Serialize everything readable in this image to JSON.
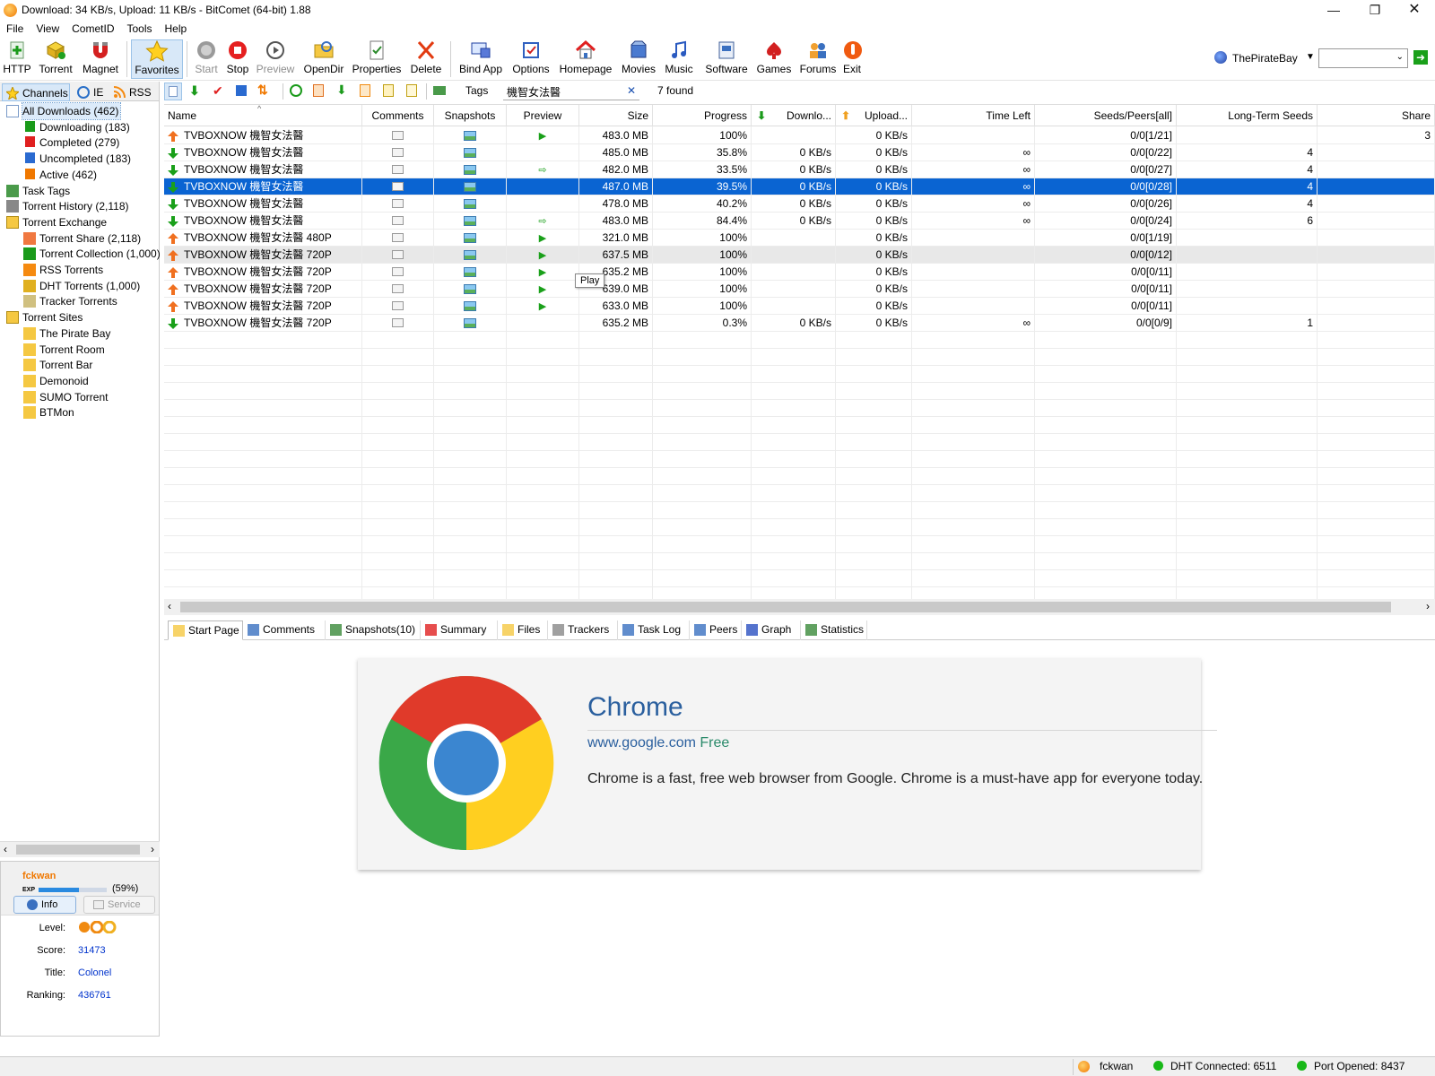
{
  "window": {
    "title": "Download: 34 KB/s, Upload: 11 KB/s - BitComet (64-bit) 1.88"
  },
  "menu": [
    "File",
    "View",
    "CometID",
    "Tools",
    "Help"
  ],
  "toolbar": {
    "buttons": [
      {
        "label": "HTTP",
        "icon": "http-add-icon"
      },
      {
        "label": "Torrent",
        "icon": "torrent-icon"
      },
      {
        "label": "Magnet",
        "icon": "magnet-icon"
      },
      {
        "label": "Favorites",
        "icon": "star-icon"
      },
      {
        "label": "Start",
        "icon": "start-icon"
      },
      {
        "label": "Stop",
        "icon": "stop-icon"
      },
      {
        "label": "Preview",
        "icon": "preview-icon"
      },
      {
        "label": "OpenDir",
        "icon": "folder-icon"
      },
      {
        "label": "Properties",
        "icon": "properties-icon"
      },
      {
        "label": "Delete",
        "icon": "delete-icon"
      },
      {
        "label": "Bind App",
        "icon": "bind-app-icon"
      },
      {
        "label": "Options",
        "icon": "options-icon"
      },
      {
        "label": "Homepage",
        "icon": "home-icon"
      },
      {
        "label": "Movies",
        "icon": "movies-icon"
      },
      {
        "label": "Music",
        "icon": "music-icon"
      },
      {
        "label": "Software",
        "icon": "software-icon"
      },
      {
        "label": "Games",
        "icon": "games-icon"
      },
      {
        "label": "Forums",
        "icon": "forums-icon"
      },
      {
        "label": "Exit",
        "icon": "exit-icon"
      }
    ],
    "site_name": "ThePirateBay",
    "search_value": ""
  },
  "left_tabs": [
    "Channels",
    "IE",
    "RSS"
  ],
  "tree": [
    {
      "label": "All Downloads (462)",
      "level": 0
    },
    {
      "label": "Downloading (183)",
      "level": 1
    },
    {
      "label": "Completed (279)",
      "level": 1
    },
    {
      "label": "Uncompleted (183)",
      "level": 1
    },
    {
      "label": "Active (462)",
      "level": 1
    },
    {
      "label": "Task Tags",
      "level": 0
    },
    {
      "label": "Torrent History (2,118)",
      "level": 0
    },
    {
      "label": "Torrent Exchange",
      "level": 0
    },
    {
      "label": "Torrent Share (2,118)",
      "level": 1
    },
    {
      "label": "Torrent Collection (1,000)",
      "level": 1
    },
    {
      "label": "RSS Torrents",
      "level": 1
    },
    {
      "label": "DHT Torrents (1,000)",
      "level": 1
    },
    {
      "label": "Tracker Torrents",
      "level": 1
    },
    {
      "label": "Torrent Sites",
      "level": 0
    },
    {
      "label": "The Pirate Bay",
      "level": 1
    },
    {
      "label": "Torrent Room",
      "level": 1
    },
    {
      "label": "Torrent Bar",
      "level": 1
    },
    {
      "label": "Demonoid",
      "level": 1
    },
    {
      "label": "SUMO Torrent",
      "level": 1
    },
    {
      "label": "BTMon",
      "level": 1
    }
  ],
  "user": {
    "name": "fckwan",
    "exp_label": "EXP",
    "exp_percent": "(59%)",
    "exp_fraction": 0.59,
    "tab_info": "Info",
    "tab_service": "Service",
    "level_label": "Level:",
    "score_label": "Score:",
    "score": "31473",
    "title_label": "Title:",
    "title": "Colonel",
    "ranking_label": "Ranking:",
    "ranking": "436761"
  },
  "filter": {
    "tags_label": "Tags",
    "search_value": "機智女法醫",
    "found": "7 found"
  },
  "columns": [
    "Name",
    "Comments",
    "Snapshots",
    "Preview",
    "Size",
    "Progress",
    "Downlo...",
    "Upload...",
    "Time Left",
    "Seeds/Peers[all]",
    "Long-Term Seeds",
    "Share"
  ],
  "rows": [
    {
      "dir": "up",
      "name": "TVBOXNOW 機智女法醫",
      "preview": "play",
      "size": "483.0 MB",
      "progress": "100%",
      "down": "",
      "up": "0 KB/s",
      "left": "",
      "seeds": "0/0[1/21]",
      "lts": "",
      "share": "3"
    },
    {
      "dir": "down",
      "name": "TVBOXNOW 機智女法醫",
      "preview": "",
      "size": "485.0 MB",
      "progress": "35.8%",
      "down": "0 KB/s",
      "up": "0 KB/s",
      "left": "∞",
      "seeds": "0/0[0/22]",
      "lts": "4",
      "share": ""
    },
    {
      "dir": "down",
      "name": "TVBOXNOW 機智女法醫",
      "preview": "partial",
      "size": "482.0 MB",
      "progress": "33.5%",
      "down": "0 KB/s",
      "up": "0 KB/s",
      "left": "∞",
      "seeds": "0/0[0/27]",
      "lts": "4",
      "share": ""
    },
    {
      "dir": "down",
      "name": "TVBOXNOW 機智女法醫",
      "preview": "",
      "size": "487.0 MB",
      "progress": "39.5%",
      "down": "0 KB/s",
      "up": "0 KB/s",
      "left": "∞",
      "seeds": "0/0[0/28]",
      "lts": "4",
      "share": ""
    },
    {
      "dir": "down",
      "name": "TVBOXNOW 機智女法醫",
      "preview": "",
      "size": "478.0 MB",
      "progress": "40.2%",
      "down": "0 KB/s",
      "up": "0 KB/s",
      "left": "∞",
      "seeds": "0/0[0/26]",
      "lts": "4",
      "share": ""
    },
    {
      "dir": "down",
      "name": "TVBOXNOW 機智女法醫",
      "preview": "partial",
      "size": "483.0 MB",
      "progress": "84.4%",
      "down": "0 KB/s",
      "up": "0 KB/s",
      "left": "∞",
      "seeds": "0/0[0/24]",
      "lts": "6",
      "share": ""
    },
    {
      "dir": "up",
      "name": "TVBOXNOW 機智女法醫 480P",
      "preview": "play",
      "size": "321.0 MB",
      "progress": "100%",
      "down": "",
      "up": "0 KB/s",
      "left": "",
      "seeds": "0/0[1/19]",
      "lts": "",
      "share": ""
    },
    {
      "dir": "up",
      "name": "TVBOXNOW 機智女法醫 720P",
      "preview": "play",
      "size": "637.5 MB",
      "progress": "100%",
      "down": "",
      "up": "0 KB/s",
      "left": "",
      "seeds": "0/0[0/12]",
      "lts": "",
      "share": ""
    },
    {
      "dir": "up",
      "name": "TVBOXNOW 機智女法醫 720P",
      "preview": "play",
      "size": "635.2 MB",
      "progress": "100%",
      "down": "",
      "up": "0 KB/s",
      "left": "",
      "seeds": "0/0[0/11]",
      "lts": "",
      "share": ""
    },
    {
      "dir": "up",
      "name": "TVBOXNOW 機智女法醫 720P",
      "preview": "play",
      "size": "639.0 MB",
      "progress": "100%",
      "down": "",
      "up": "0 KB/s",
      "left": "",
      "seeds": "0/0[0/11]",
      "lts": "",
      "share": ""
    },
    {
      "dir": "up",
      "name": "TVBOXNOW 機智女法醫 720P",
      "preview": "play",
      "size": "633.0 MB",
      "progress": "100%",
      "down": "",
      "up": "0 KB/s",
      "left": "",
      "seeds": "0/0[0/11]",
      "lts": "",
      "share": ""
    },
    {
      "dir": "down",
      "name": "TVBOXNOW 機智女法醫 720P",
      "preview": "",
      "size": "635.2 MB",
      "progress": "0.3%",
      "down": "0 KB/s",
      "up": "0 KB/s",
      "left": "∞",
      "seeds": "0/0[0/9]",
      "lts": "1",
      "share": ""
    }
  ],
  "tooltip": "Play",
  "bottom_tabs": [
    "Start Page",
    "Comments",
    "Snapshots(10)",
    "Summary",
    "Files",
    "Trackers",
    "Task Log",
    "Peers",
    "Graph",
    "Statistics"
  ],
  "start_page": {
    "app_name": "Chrome",
    "publisher": "www.google.com",
    "price": "Free",
    "description": "Chrome is a fast, free web browser from Google. Chrome is a must-have app for everyone today."
  },
  "status": {
    "user": "fckwan",
    "dht": "DHT Connected: 6511",
    "port": "Port Opened: 8437"
  },
  "colors": {
    "selection": "#0a64d2",
    "link_blue": "#2a5f9e",
    "accent_orange": "#f07800",
    "green": "#18b818"
  }
}
